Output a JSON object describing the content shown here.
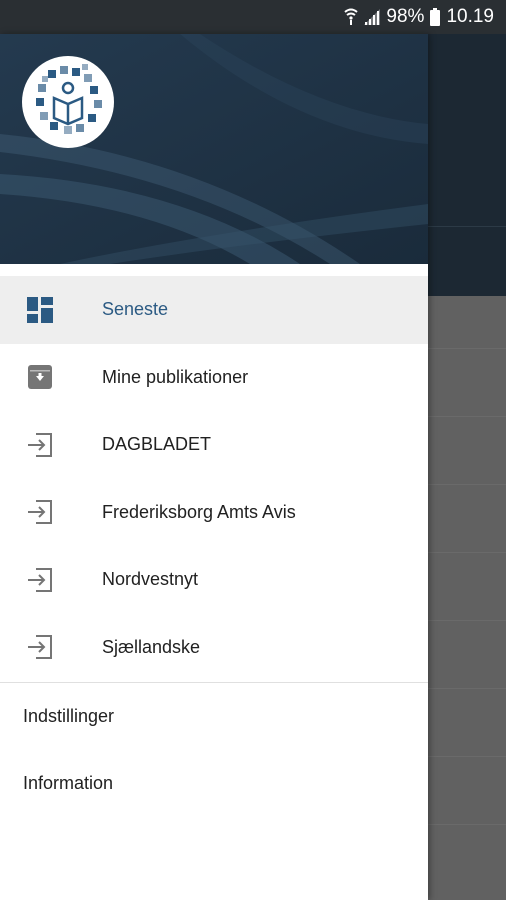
{
  "status_bar": {
    "battery": "98%",
    "time": "10.19",
    "icons": [
      "wifi-icon",
      "signal-icon",
      "battery-icon"
    ]
  },
  "drawer": {
    "logo_icon": "book-logo-icon",
    "nav_items": [
      {
        "label": "Seneste",
        "icon": "dashboard-icon",
        "active": true
      },
      {
        "label": "Mine publikationer",
        "icon": "archive-icon",
        "active": false
      },
      {
        "label": "DAGBLADET",
        "icon": "login-arrow-icon",
        "active": false
      },
      {
        "label": "Frederiksborg Amts Avis",
        "icon": "login-arrow-icon",
        "active": false
      },
      {
        "label": "Nordvestnyt",
        "icon": "login-arrow-icon",
        "active": false
      },
      {
        "label": "Sjællandske",
        "icon": "login-arrow-icon",
        "active": false
      }
    ],
    "footer_items": [
      {
        "label": "Indstillinger"
      },
      {
        "label": "Information"
      }
    ]
  },
  "colors": {
    "header_bg": "#1e3244",
    "active_text": "#2b5a83",
    "active_bg": "#eeeeee",
    "scrim": "#616161"
  }
}
